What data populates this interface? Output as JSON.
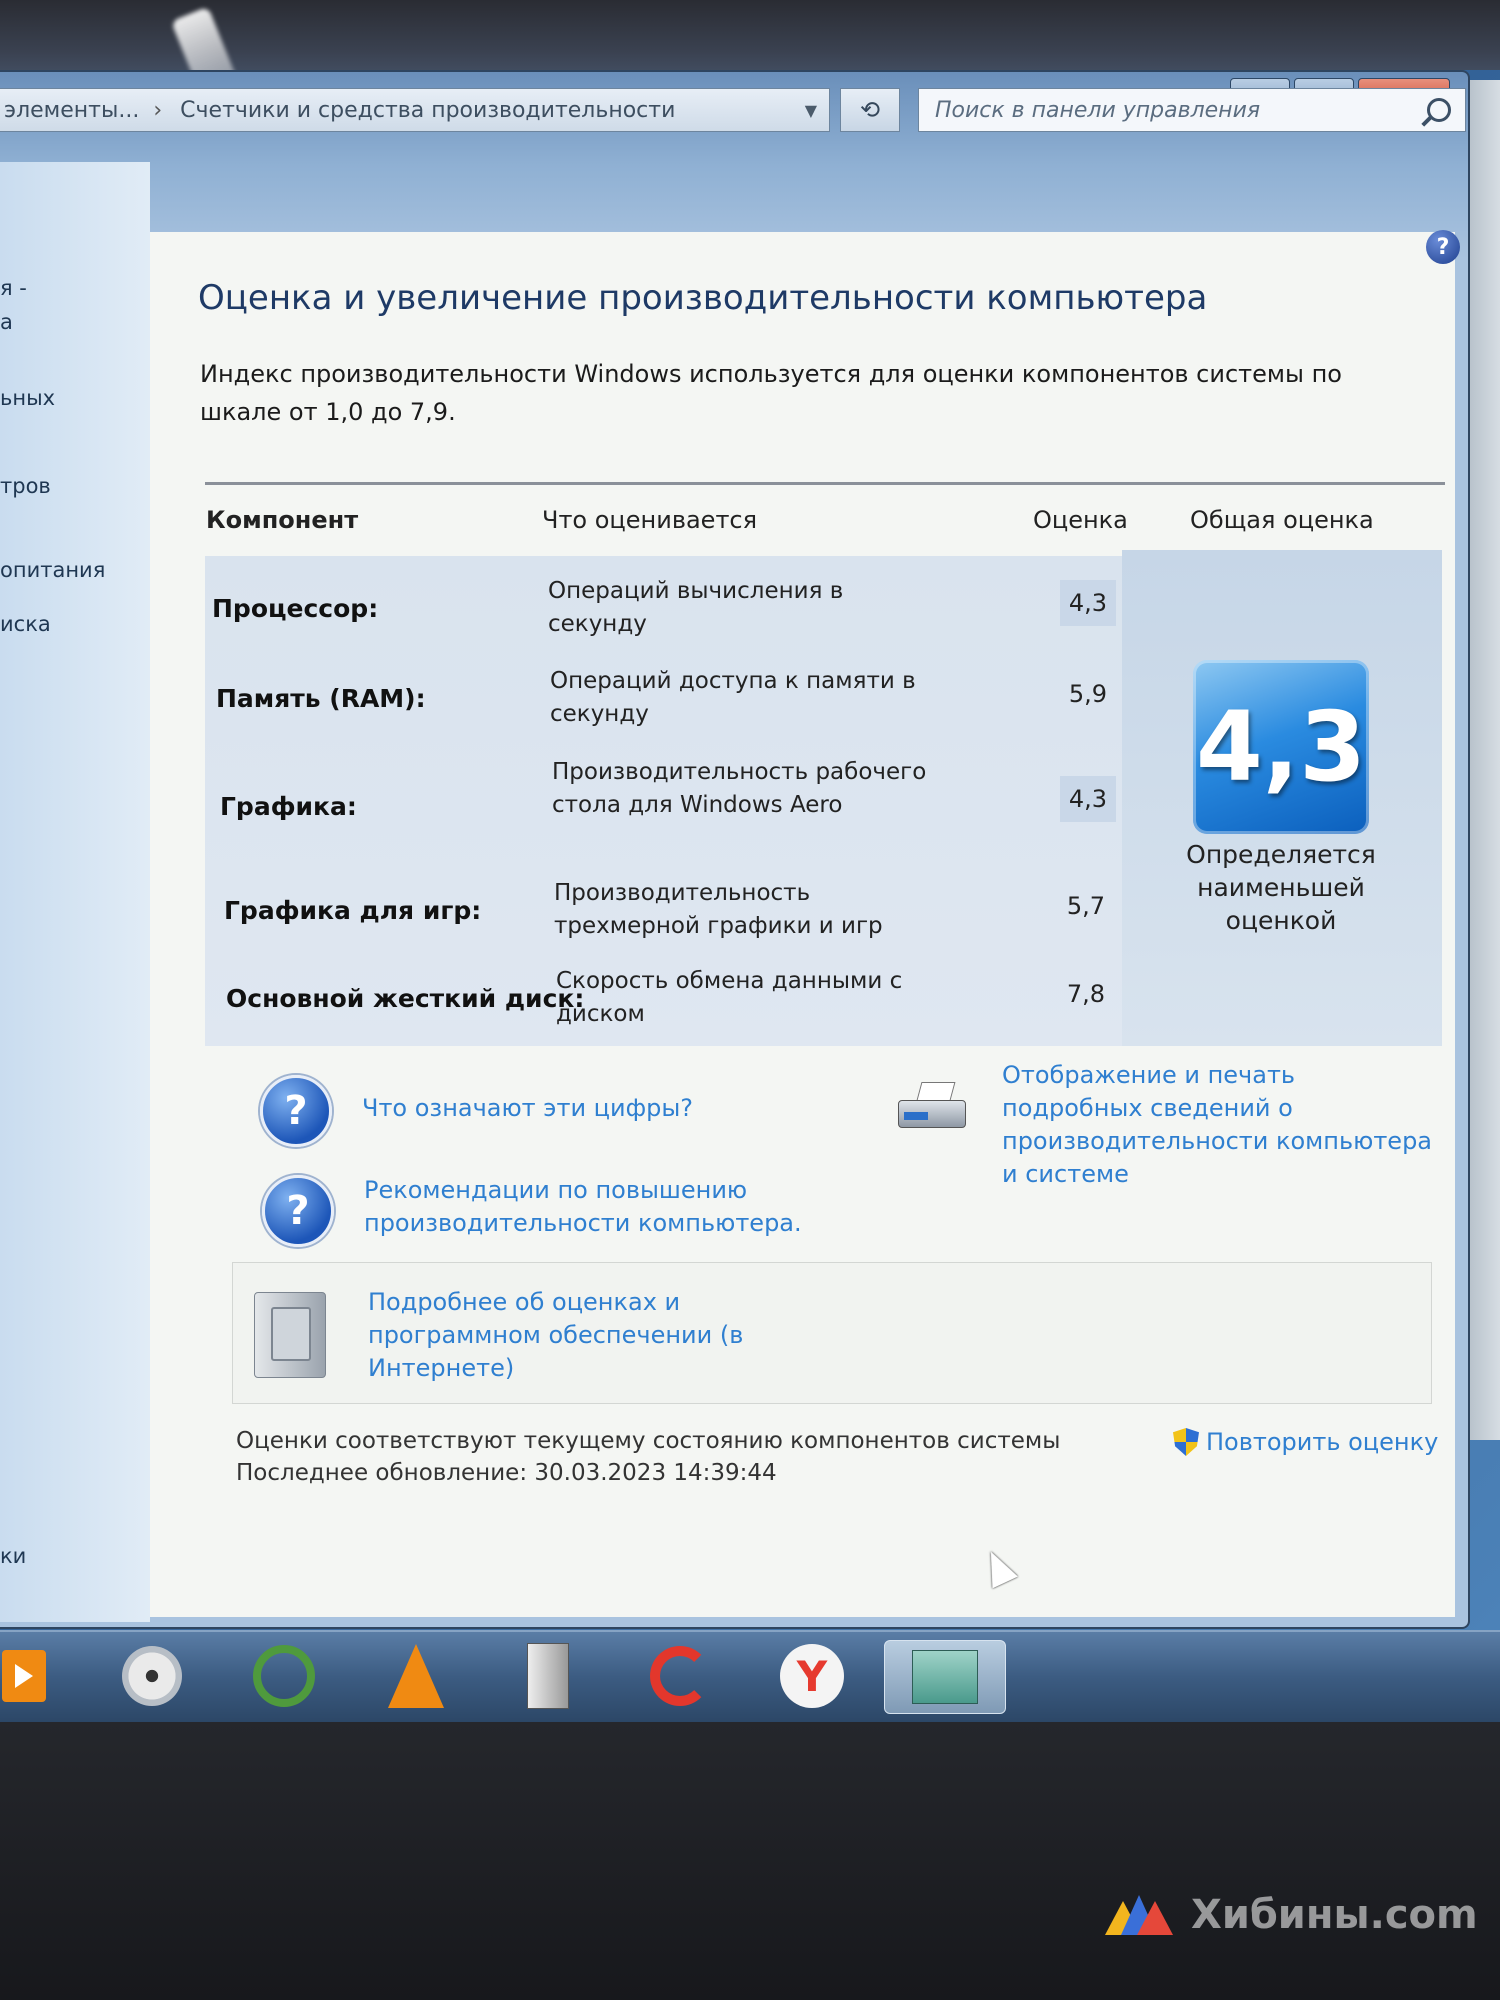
{
  "window": {
    "breadcrumb": [
      "элементы...",
      "Счетчики и средства производительности"
    ],
    "search_placeholder": "Поиск в панели управления",
    "caption_buttons": {
      "close": "X"
    }
  },
  "nav": {
    "items": [
      "я -",
      "а",
      "ьных",
      "тров",
      "опитания",
      "иска",
      "ки"
    ]
  },
  "page": {
    "title": "Оценка и увеличение производительности компьютера",
    "intro": "Индекс производительности Windows используется для оценки компонентов системы по шкале от 1,0 до 7,9.",
    "help": "?"
  },
  "table": {
    "headers": {
      "component": "Компонент",
      "what": "Что оценивается",
      "score": "Оценка",
      "overall": "Общая оценка"
    },
    "rows": [
      {
        "component": "Процессор:",
        "what": "Операций вычисления в секунду",
        "score": "4,3"
      },
      {
        "component": "Память (RAM):",
        "what": "Операций доступа к памяти в секунду",
        "score": "5,9"
      },
      {
        "component": "Графика:",
        "what": "Производительность рабочего стола для Windows Aero",
        "score": "4,3"
      },
      {
        "component": "Графика для игр:",
        "what": "Производительность трехмерной графики и игр",
        "score": "5,7"
      },
      {
        "component": "Основной жесткий диск:",
        "what": "Скорость обмена данными с диском",
        "score": "7,8"
      }
    ],
    "base_score": "4,3",
    "base_caption": "Определяется наименьшей оценкой"
  },
  "links": {
    "what_numbers": "Что означают эти цифры?",
    "tips": "Рекомендации по повышению производительности компьютера.",
    "print": "Отображение и печать подробных сведений о производительности компьютера и системе",
    "online": "Подробнее об оценках и программном обеспечении (в Интернете)",
    "rerun": "Повторить оценку"
  },
  "status": {
    "current": "Оценки соответствуют текущему состоянию компонентов системы",
    "updated": "Последнее обновление: 30.03.2023 14:39:44"
  },
  "taskbar": {
    "yandex_letter": "Y"
  },
  "watermark": "Хибины.com",
  "colors": {
    "link": "#2f7fd0",
    "title": "#1e3a66",
    "tile": "#2a8be0"
  }
}
